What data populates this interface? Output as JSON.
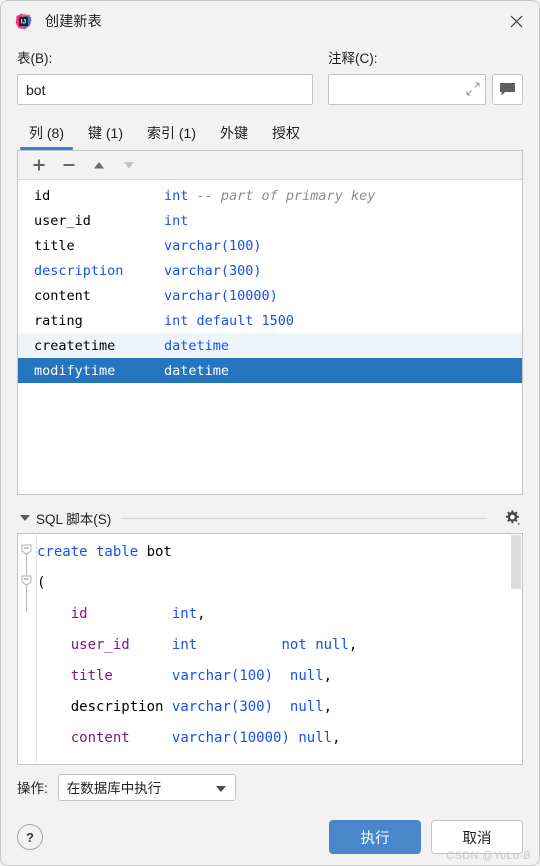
{
  "window": {
    "title": "创建新表",
    "app_icon": "intellij-idea-icon",
    "close_icon": "close-icon"
  },
  "form": {
    "table_label": "表(B):",
    "table_value": "bot",
    "table_placeholder": "",
    "comment_label": "注释(C):",
    "comment_value": "",
    "comment_placeholder": "",
    "expand_icon": "expand-icon",
    "bubble_icon": "comment-bubble-icon"
  },
  "tabs": [
    {
      "label": "列 (8)",
      "name": "tab-columns",
      "active": true
    },
    {
      "label": "键 (1)",
      "name": "tab-keys",
      "active": false
    },
    {
      "label": "索引 (1)",
      "name": "tab-indexes",
      "active": false
    },
    {
      "label": "外键",
      "name": "tab-foreign-keys",
      "active": false
    },
    {
      "label": "授权",
      "name": "tab-grants",
      "active": false
    }
  ],
  "columns_toolbar": [
    {
      "name": "add-column-button",
      "icon": "plus-icon",
      "enabled": true
    },
    {
      "name": "remove-column-button",
      "icon": "minus-icon",
      "enabled": true
    },
    {
      "name": "move-up-button",
      "icon": "arrow-up-icon",
      "enabled": true
    },
    {
      "name": "move-down-button",
      "icon": "arrow-down-icon",
      "enabled": false
    }
  ],
  "columns": [
    {
      "name": "id",
      "type": "int",
      "comment": "-- part of primary key",
      "state": "normal",
      "name_color": "#000000"
    },
    {
      "name": "user_id",
      "type": "int",
      "comment": "",
      "state": "normal",
      "name_color": "#000000"
    },
    {
      "name": "title",
      "type": "varchar(100)",
      "comment": "",
      "state": "normal",
      "name_color": "#000000"
    },
    {
      "name": "description",
      "type": "varchar(300)",
      "comment": "",
      "state": "normal",
      "name_color": "#1750eb"
    },
    {
      "name": "content",
      "type": "varchar(10000)",
      "comment": "",
      "state": "normal",
      "name_color": "#000000"
    },
    {
      "name": "rating",
      "type": "int default 1500",
      "comment": "",
      "state": "normal",
      "name_color": "#000000"
    },
    {
      "name": "createtime",
      "type": "datetime",
      "comment": "",
      "state": "hover",
      "name_color": "#000000"
    },
    {
      "name": "modifytime",
      "type": "datetime",
      "comment": "",
      "state": "selected",
      "name_color": "#ffffff"
    }
  ],
  "sql_section": {
    "title": "SQL 脚本(S)",
    "collapse_icon": "triangle-down-icon",
    "settings_icon": "gear-icon",
    "lines": [
      [
        {
          "t": "create table ",
          "c": "k"
        },
        {
          "t": "bot",
          "c": "pl"
        }
      ],
      [
        {
          "t": "(",
          "c": "pl"
        }
      ],
      [
        {
          "t": "    ",
          "c": "pl"
        },
        {
          "t": "id",
          "c": "id"
        },
        {
          "t": "          ",
          "c": "pl"
        },
        {
          "t": "int",
          "c": "ty"
        },
        {
          "t": ",",
          "c": "pl"
        }
      ],
      [
        {
          "t": "    ",
          "c": "pl"
        },
        {
          "t": "user_id",
          "c": "id"
        },
        {
          "t": "     ",
          "c": "pl"
        },
        {
          "t": "int",
          "c": "ty"
        },
        {
          "t": "          ",
          "c": "pl"
        },
        {
          "t": "not null",
          "c": "k"
        },
        {
          "t": ",",
          "c": "pl"
        }
      ],
      [
        {
          "t": "    ",
          "c": "pl"
        },
        {
          "t": "title",
          "c": "id"
        },
        {
          "t": "       ",
          "c": "pl"
        },
        {
          "t": "varchar(",
          "c": "ty"
        },
        {
          "t": "100",
          "c": "n"
        },
        {
          "t": ")",
          "c": "ty"
        },
        {
          "t": "  ",
          "c": "pl"
        },
        {
          "t": "null",
          "c": "k"
        },
        {
          "t": ",",
          "c": "pl"
        }
      ],
      [
        {
          "t": "    ",
          "c": "pl"
        },
        {
          "t": "description",
          "c": "pl"
        },
        {
          "t": " ",
          "c": "pl"
        },
        {
          "t": "varchar(",
          "c": "ty"
        },
        {
          "t": "300",
          "c": "n"
        },
        {
          "t": ")",
          "c": "ty"
        },
        {
          "t": "  ",
          "c": "pl"
        },
        {
          "t": "null",
          "c": "k"
        },
        {
          "t": ",",
          "c": "pl"
        }
      ],
      [
        {
          "t": "    ",
          "c": "pl"
        },
        {
          "t": "content",
          "c": "id"
        },
        {
          "t": "     ",
          "c": "pl"
        },
        {
          "t": "varchar(",
          "c": "ty"
        },
        {
          "t": "10000",
          "c": "n"
        },
        {
          "t": ")",
          "c": "ty"
        },
        {
          "t": " ",
          "c": "pl"
        },
        {
          "t": "null",
          "c": "k"
        },
        {
          "t": ",",
          "c": "pl"
        }
      ]
    ],
    "scrollbar": "vertical-scrollbar"
  },
  "footer": {
    "action_label": "操作:",
    "action_value": "在数据库中执行",
    "dropdown_icon": "chevron-down-icon",
    "help_label": "?",
    "execute_label": "执行",
    "cancel_label": "取消"
  },
  "watermark": "CSDN @YoLo-B",
  "colors": {
    "accent_blue": "#3b7dd8",
    "selection_blue": "#2675bf",
    "hover_blue": "#edf5fc",
    "primary_button": "#4a87ca",
    "keyword_blue": "#1750eb",
    "identifier_purple": "#871094",
    "comment_gray": "#8c8c8c",
    "dialog_bg": "#f2f2f2"
  }
}
